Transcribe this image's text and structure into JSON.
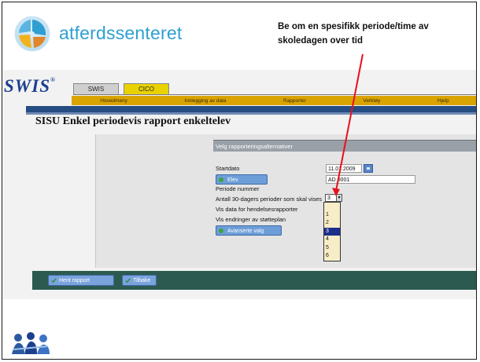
{
  "brand": {
    "name": "atferdssenteret",
    "logo_icon": "atferdssenteret-logo"
  },
  "callout": {
    "text": "Be om en spesifikk periode/time av skoledagen over tid",
    "color": "#111111",
    "arrow_color": "#e8101a"
  },
  "app": {
    "logo": "SWIS",
    "tabs": [
      {
        "label": "SWIS",
        "active": false
      },
      {
        "label": "CICO",
        "active": true
      }
    ],
    "nav": [
      "Hovedmeny",
      "Innlegging av data",
      "Rapporter",
      "Verktøy",
      "Hjelp"
    ],
    "page_title": "SISU Enkel periodevis rapport enkeltelev",
    "section_title": "Velg rapporteringsalternativer",
    "fields": {
      "startdato_label": "Startdato",
      "startdato_value": "11.01.2009",
      "elev_button": "Elev",
      "elev_value": "AD 0001",
      "periode_label": "Periode nummer",
      "periode_value": "3",
      "antall_label": "Antall 30-dagers perioder som skal vises",
      "vis_data_label": "Vis data for hendelsesrapporter",
      "vis_endringer_label": "Vis endringer av støtteplan",
      "avanserte_button": "Avanserte valg"
    },
    "periode_options": [
      "",
      "1",
      "2",
      "3",
      "4",
      "5",
      "6"
    ],
    "periode_selected_index": 3,
    "footer_buttons": {
      "hent": "Hent rapport",
      "tilbake": "Tilbake"
    },
    "colors": {
      "nav": "#d9a400",
      "header_bar": "#264d83",
      "footer_bar": "#2c5a50",
      "active_tab": "#e8d200"
    }
  },
  "corner_logo": "students-logo"
}
